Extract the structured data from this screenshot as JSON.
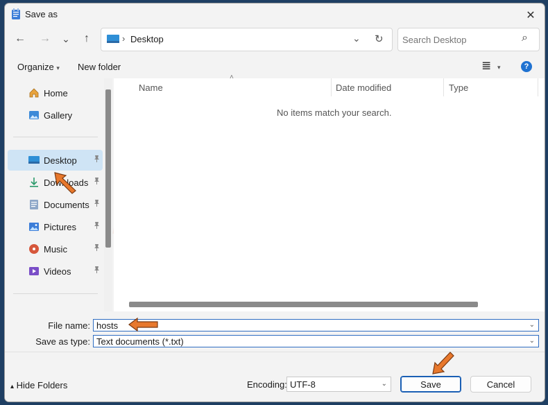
{
  "window": {
    "title": "Save as",
    "close_glyph": "✕"
  },
  "nav": {
    "back_glyph": "←",
    "forward_glyph": "→",
    "recent_glyph": "⌄",
    "up_glyph": "↑",
    "address": {
      "separator": "›",
      "location": "Desktop",
      "dropdown_glyph": "⌄",
      "refresh_glyph": "↻"
    },
    "search": {
      "placeholder": "Search Desktop",
      "icon_glyph": "⌕"
    }
  },
  "toolbar": {
    "organize_label": "Organize",
    "organize_caret": "▾",
    "new_folder_label": "New folder",
    "view_glyph": "≣",
    "view_caret": "▾",
    "help_glyph": "?"
  },
  "sidebar": {
    "items": [
      {
        "label": "Home",
        "icon": "home-icon",
        "pinned": false
      },
      {
        "label": "Gallery",
        "icon": "gallery-icon",
        "pinned": false
      },
      {
        "label": "Desktop",
        "icon": "desktop-icon",
        "pinned": true,
        "selected": true
      },
      {
        "label": "Downloads",
        "icon": "downloads-icon",
        "pinned": true
      },
      {
        "label": "Documents",
        "icon": "documents-icon",
        "pinned": true
      },
      {
        "label": "Pictures",
        "icon": "pictures-icon",
        "pinned": true
      },
      {
        "label": "Music",
        "icon": "music-icon",
        "pinned": true
      },
      {
        "label": "Videos",
        "icon": "videos-icon",
        "pinned": true
      }
    ],
    "pin_glyph": "📌"
  },
  "file_list": {
    "columns": [
      "Name",
      "Date modified",
      "Type"
    ],
    "sort_glyph": "˄",
    "empty_message": "No items match your search."
  },
  "form": {
    "file_name_label": "File name:",
    "file_name_value": "hosts",
    "save_type_label": "Save as type:",
    "save_type_value": "Text documents (*.txt)",
    "chevron_glyph": "⌄"
  },
  "footer": {
    "hide_folders_label": "Hide Folders",
    "hide_folders_glyph": "▴",
    "encoding_label": "Encoding:",
    "encoding_value": "UTF-8",
    "save_label": "Save",
    "cancel_label": "Cancel"
  },
  "colors": {
    "accent": "#1a5fb4",
    "selection": "#cfe4f5",
    "annotation_arrow": "#e8782c"
  }
}
